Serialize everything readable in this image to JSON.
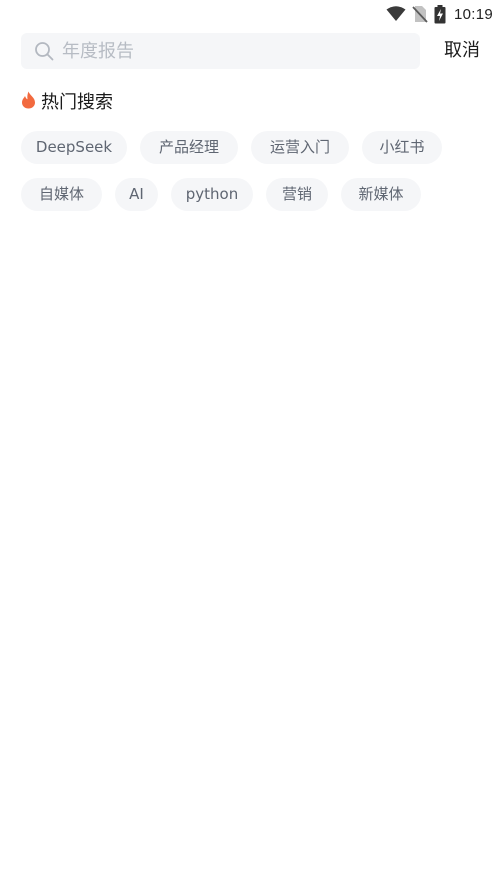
{
  "status_bar": {
    "time": "10:19",
    "icons": [
      "wifi-icon",
      "no-sim-icon",
      "battery-charging-icon"
    ]
  },
  "search": {
    "placeholder": "年度报告",
    "value": "",
    "icon": "search-icon",
    "cancel_label": "取消"
  },
  "hot_search": {
    "icon": "fire-icon",
    "title": "热门搜索",
    "accent_color": "#f26a3f",
    "tags": [
      "DeepSeek",
      "产品经理",
      "运营入门",
      "小红书",
      "自媒体",
      "AI",
      "python",
      "营销",
      "新媒体"
    ]
  }
}
